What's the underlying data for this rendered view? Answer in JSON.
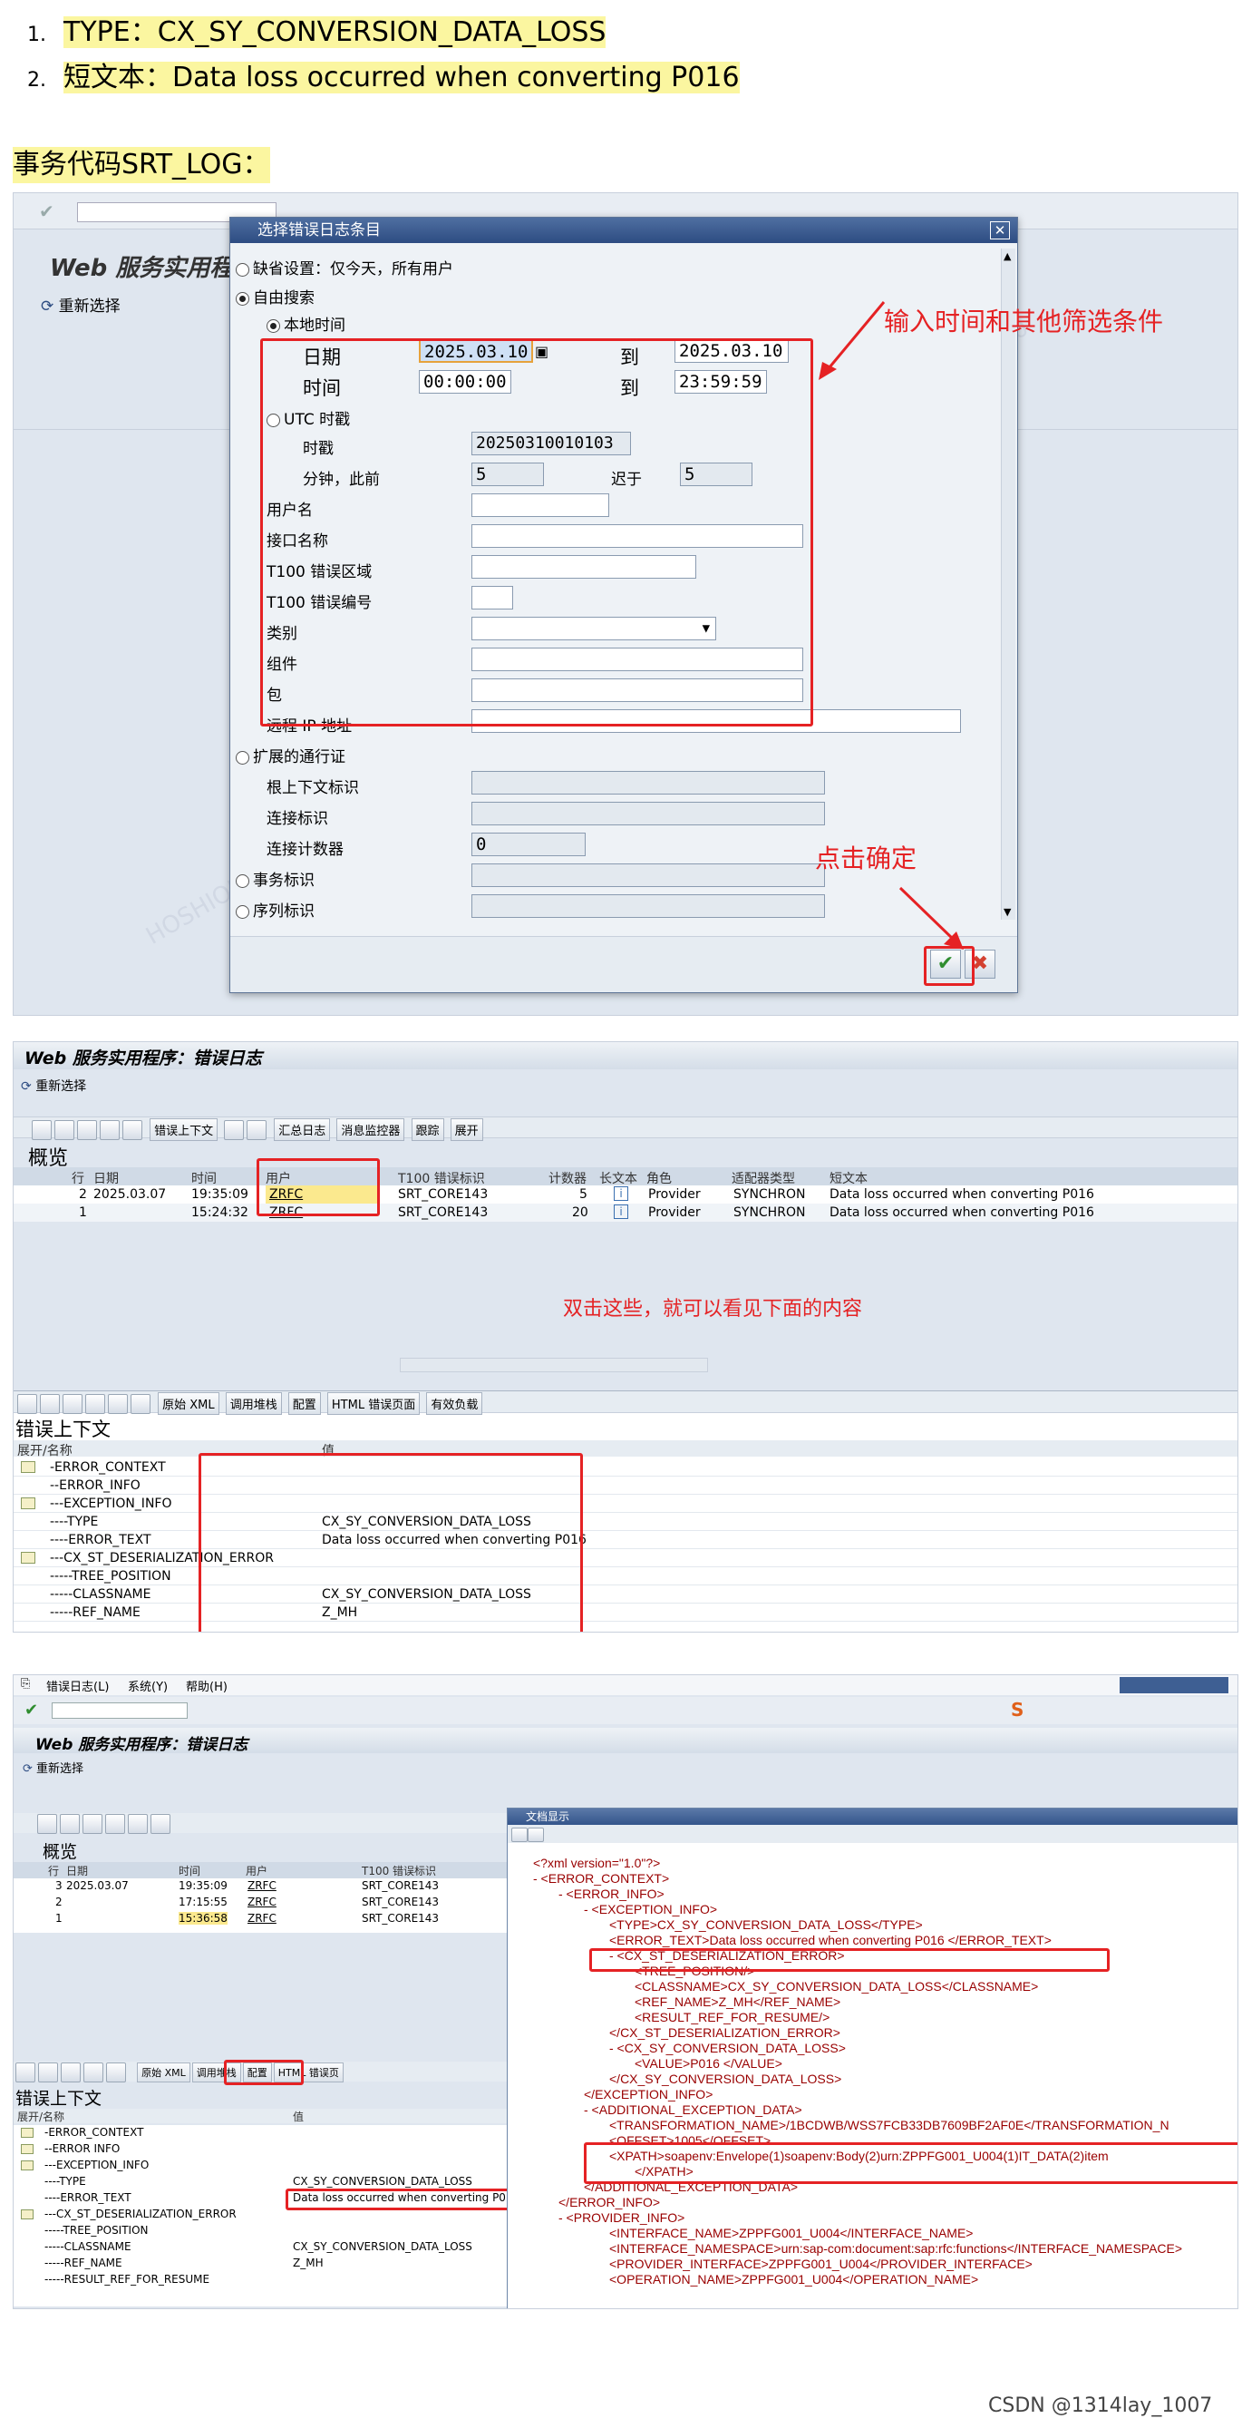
{
  "intro": {
    "items": [
      {
        "num": "1.",
        "text": "TYPE：CX_SY_CONVERSION_DATA_LOSS"
      },
      {
        "num": "2.",
        "text": "短文本：Data loss occurred when converting P016"
      }
    ],
    "section_heading": "事务代码SRT_LOG："
  },
  "shot1": {
    "app_title": "Web 服务实用程",
    "reselect": "重新选择",
    "dialog": {
      "title": "选择错误日志条目",
      "radio_default": "缺省设置：仅今天，所有用户",
      "radio_free": "自由搜索",
      "radio_local": "本地时间",
      "date_label": "日期",
      "date_from": "2025.03.10",
      "to_label": "到",
      "date_to": "2025.03.10",
      "time_label": "时间",
      "time_from": "00:00:00",
      "time_to": "23:59:59",
      "radio_utc": "UTC 时戳",
      "timestamp_label": "时戳",
      "timestamp_value": "20250310010103",
      "minutes_label": "分钟，此前",
      "minutes_value": "5",
      "later_label": "迟于",
      "later_value": "5",
      "user_label": "用户名",
      "iface_label": "接口名称",
      "t100_area_label": "T100 错误区域",
      "t100_num_label": "T100 错误编号",
      "category_label": "类别",
      "component_label": "组件",
      "package_label": "包",
      "remote_ip_label": "远程 IP 地址",
      "radio_ext": "扩展的通行证",
      "root_ctx_label": "根上下文标识",
      "conn_id_label": "连接标识",
      "conn_cnt_label": "连接计数器",
      "conn_cnt_value": "0",
      "radio_trans": "事务标识",
      "radio_seq": "序列标识"
    },
    "annotation_filter": "输入时间和其他筛选条件",
    "annotation_ok": "点击确定"
  },
  "shot2": {
    "app_title": "Web 服务实用程序：错误日志",
    "reselect": "重新选择",
    "toolbar_buttons": [
      "错误上下文",
      "汇总日志",
      "消息监控器",
      "跟踪",
      "展开"
    ],
    "overview": "概览",
    "columns": [
      "行",
      "日期",
      "时间",
      "用户",
      "T100 错误标识",
      "计数器",
      "长文本",
      "角色",
      "适配器类型",
      "短文本"
    ],
    "rows": [
      {
        "line": "2",
        "date": "2025.03.07",
        "time": "19:35:09",
        "user": "ZRFC",
        "t100": "SRT_CORE143",
        "count": "5",
        "role": "Provider",
        "adapter": "SYNCHRON",
        "short": "Data loss occurred when converting  P016"
      },
      {
        "line": "1",
        "date": "",
        "time": "15:24:32",
        "user": "ZRFC",
        "t100": "SRT_CORE143",
        "count": "20",
        "role": "Provider",
        "adapter": "SYNCHRON",
        "short": "Data loss occurred when converting  P016"
      }
    ],
    "annotation": "双击这些，就可以看见下面的内容",
    "bottom_buttons": [
      "原始 XML",
      "调用堆栈",
      "配置",
      "HTML 错误页面",
      "有效负载"
    ],
    "ctx_title": "错误上下文",
    "tree_header_name": "展开/名称",
    "tree_header_value": "值",
    "tree": [
      {
        "name": "-ERROR_CONTEXT",
        "value": ""
      },
      {
        "name": "--ERROR_INFO",
        "value": ""
      },
      {
        "name": "---EXCEPTION_INFO",
        "value": ""
      },
      {
        "name": "----TYPE",
        "value": "CX_SY_CONVERSION_DATA_LOSS"
      },
      {
        "name": "----ERROR_TEXT",
        "value": "Data loss occurred when converting P016"
      },
      {
        "name": "---CX_ST_DESERIALIZATION_ERROR",
        "value": ""
      },
      {
        "name": "-----TREE_POSITION",
        "value": ""
      },
      {
        "name": "-----CLASSNAME",
        "value": "CX_SY_CONVERSION_DATA_LOSS"
      },
      {
        "name": "-----REF_NAME",
        "value": "Z_MH"
      }
    ]
  },
  "shot3": {
    "menu": [
      "错误日志(L)",
      "系统(Y)",
      "帮助(H)"
    ],
    "app_title": "Web 服务实用程序：错误日志",
    "reselect": "重新选择",
    "overview": "概览",
    "columns": [
      "行",
      "日期",
      "时间",
      "用户",
      "T100 错误标识"
    ],
    "rows": [
      {
        "line": "3",
        "date": "2025.03.07",
        "time": "19:35:09",
        "user": "ZRFC",
        "t100": "SRT_CORE143"
      },
      {
        "line": "2",
        "date": "",
        "time": "17:15:55",
        "user": "ZRFC",
        "t100": "SRT_CORE143"
      },
      {
        "line": "1",
        "date": "",
        "time": "15:36:58",
        "user": "ZRFC",
        "t100": "SRT_CORE143"
      }
    ],
    "raw_xml_button": "原始 XML",
    "call_stack_button": "调用堆栈",
    "config_button": "配置",
    "html_button": "HTML 错误页",
    "ctx_title": "错误上下文",
    "tree_header_name": "展开/名称",
    "tree_header_value": "值",
    "tree": [
      {
        "name": "-ERROR_CONTEXT",
        "value": ""
      },
      {
        "name": "--ERROR INFO",
        "value": ""
      },
      {
        "name": "---EXCEPTION_INFO",
        "value": ""
      },
      {
        "name": "----TYPE",
        "value": "CX_SY_CONVERSION_DATA_LOSS"
      },
      {
        "name": "----ERROR_TEXT",
        "value": "Data loss occurred when converting P016"
      },
      {
        "name": "---CX_ST_DESERIALIZATION_ERROR",
        "value": ""
      },
      {
        "name": "-----TREE_POSITION",
        "value": ""
      },
      {
        "name": "-----CLASSNAME",
        "value": "CX_SY_CONVERSION_DATA_LOSS"
      },
      {
        "name": "-----REF_NAME",
        "value": "Z_MH"
      },
      {
        "name": "-----RESULT_REF_FOR_RESUME",
        "value": ""
      }
    ],
    "doc_window_title": "文档显示",
    "xml_lines": [
      {
        "indent": 0,
        "text": "<?xml version=\"1.0\"?>"
      },
      {
        "indent": 0,
        "text": "- <ERROR_CONTEXT>"
      },
      {
        "indent": 1,
        "text": "- <ERROR_INFO>"
      },
      {
        "indent": 2,
        "text": "- <EXCEPTION_INFO>"
      },
      {
        "indent": 3,
        "text": "<TYPE>CX_SY_CONVERSION_DATA_LOSS</TYPE>"
      },
      {
        "indent": 3,
        "text": "<ERROR_TEXT>Data loss occurred when converting P016 </ERROR_TEXT>"
      },
      {
        "indent": 3,
        "text": "- <CX_ST_DESERIALIZATION_ERROR>"
      },
      {
        "indent": 4,
        "text": "<TREE_POSITION/>"
      },
      {
        "indent": 4,
        "text": "<CLASSNAME>CX_SY_CONVERSION_DATA_LOSS</CLASSNAME>"
      },
      {
        "indent": 4,
        "text": "<REF_NAME>Z_MH</REF_NAME>"
      },
      {
        "indent": 4,
        "text": "<RESULT_REF_FOR_RESUME/>"
      },
      {
        "indent": 3,
        "text": "</CX_ST_DESERIALIZATION_ERROR>"
      },
      {
        "indent": 3,
        "text": "- <CX_SY_CONVERSION_DATA_LOSS>"
      },
      {
        "indent": 4,
        "text": "<VALUE>P016 </VALUE>"
      },
      {
        "indent": 3,
        "text": "</CX_SY_CONVERSION_DATA_LOSS>"
      },
      {
        "indent": 2,
        "text": "</EXCEPTION_INFO>"
      },
      {
        "indent": 2,
        "text": "- <ADDITIONAL_EXCEPTION_DATA>"
      },
      {
        "indent": 3,
        "text": "<TRANSFORMATION_NAME>/1BCDWB/WSS7FCB33DB7609BF2AF0E</TRANSFORMATION_N"
      },
      {
        "indent": 3,
        "text": "<OFFSET>1005</OFFSET>"
      },
      {
        "indent": 3,
        "text": "<XPATH>soapenv:Envelope(1)soapenv:Body(2)urn:ZPPFG001_U004(1)IT_DATA(2)item"
      },
      {
        "indent": 4,
        "text": "</XPATH>"
      },
      {
        "indent": 2,
        "text": "</ADDITIONAL_EXCEPTION_DATA>"
      },
      {
        "indent": 1,
        "text": "</ERROR_INFO>"
      },
      {
        "indent": 1,
        "text": "- <PROVIDER_INFO>"
      },
      {
        "indent": 3,
        "text": "<INTERFACE_NAME>ZPPFG001_U004</INTERFACE_NAME>"
      },
      {
        "indent": 3,
        "text": "<INTERFACE_NAMESPACE>urn:sap-com:document:sap:rfc:functions</INTERFACE_NAMESPACE>"
      },
      {
        "indent": 3,
        "text": "<PROVIDER_INTERFACE>ZPPFG001_U004</PROVIDER_INTERFACE>"
      },
      {
        "indent": 3,
        "text": "<OPERATION_NAME>ZPPFG001_U004</OPERATION_NAME>"
      }
    ]
  },
  "footer": "CSDN @1314lay_1007",
  "colors": {
    "annotation_red": "#e52224",
    "highlight_yellow": "#fbf6a0",
    "sap_title_blue": "#2d4c82"
  }
}
